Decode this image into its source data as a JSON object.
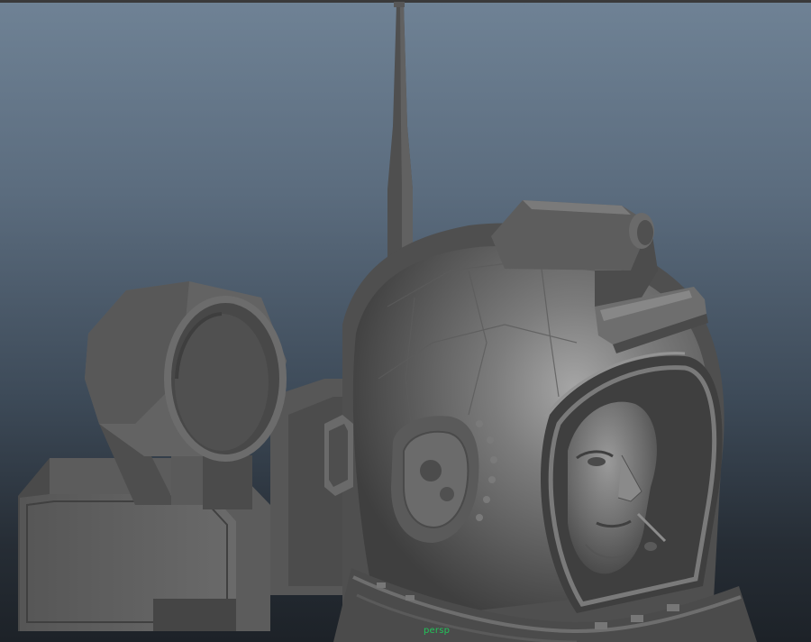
{
  "viewport": {
    "camera_label": "persp",
    "camera_label_color": "#22c35a",
    "background_top_color": "#6f8295",
    "background_bottom_color": "#1d2228",
    "model_color": "#5e5e5e"
  },
  "model": {
    "parts": [
      "antenna-icon",
      "searchlight-icon",
      "backpack-icon",
      "helmet-icon",
      "face-icon",
      "visor-icon",
      "ear-dial-icon",
      "neck-ring-icon"
    ]
  }
}
